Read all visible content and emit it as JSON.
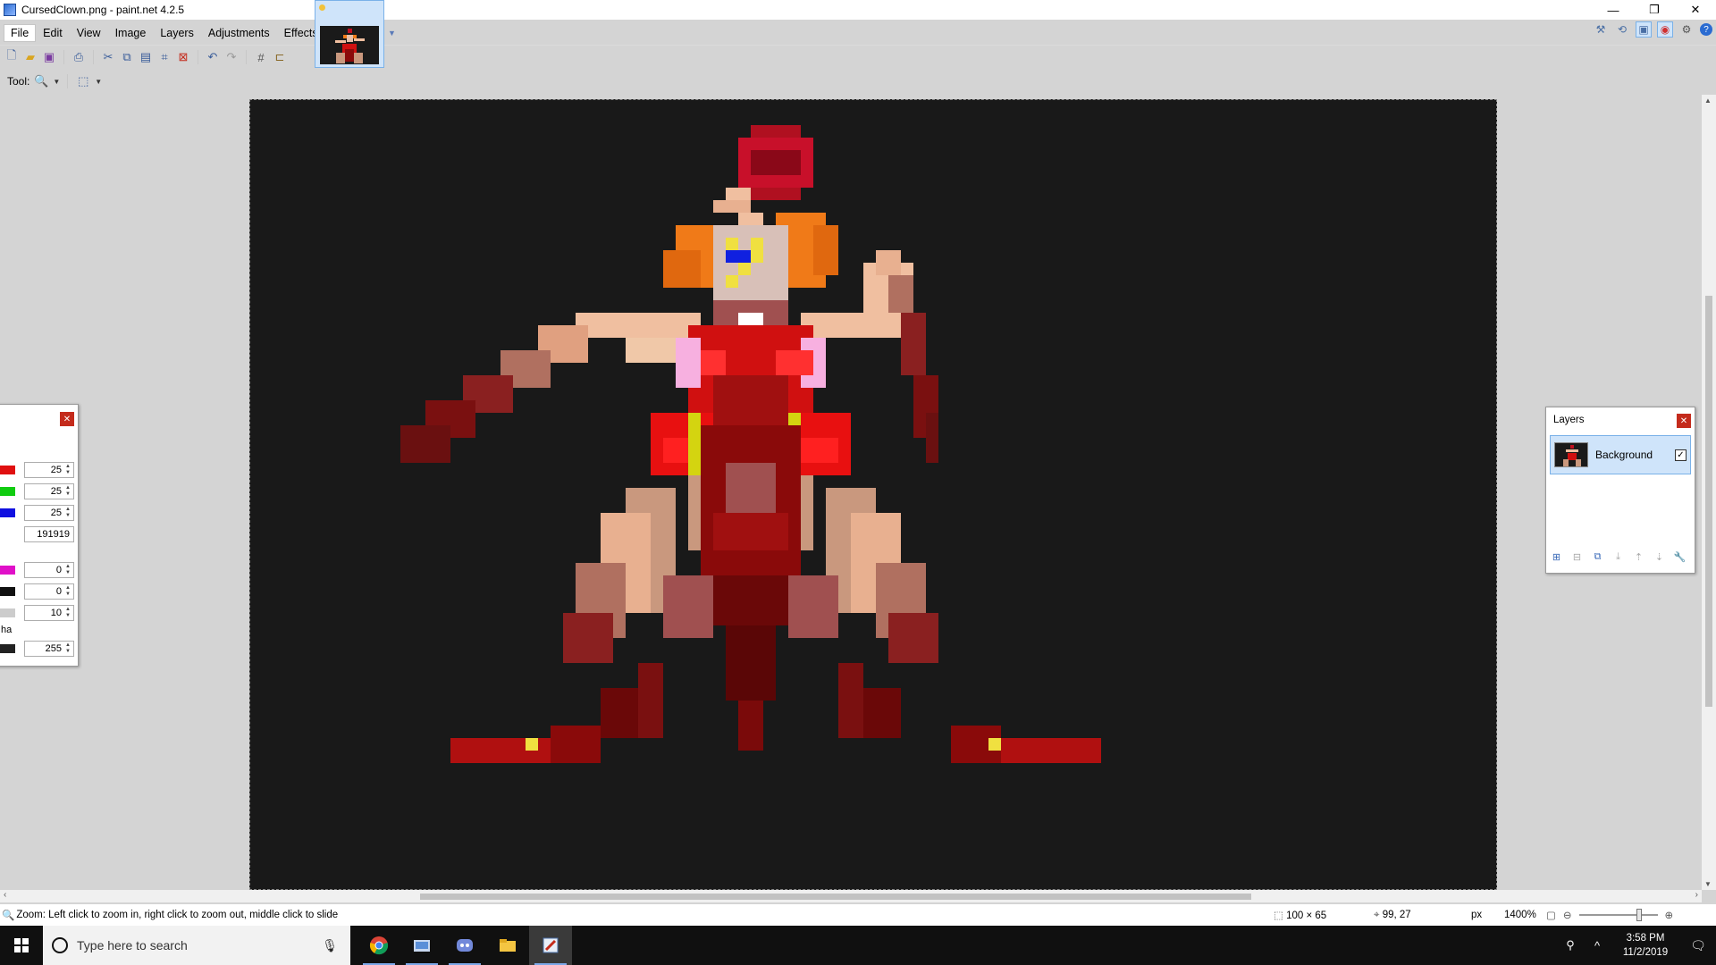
{
  "window": {
    "title": "CursedClown.png - paint.net 4.2.5",
    "controls": [
      "—",
      "❐",
      "✕"
    ]
  },
  "menu": {
    "items": [
      "File",
      "Edit",
      "View",
      "Image",
      "Layers",
      "Adjustments",
      "Effects"
    ]
  },
  "toolrow": {
    "label": "Tool:",
    "tool_icon": "zoom-icon",
    "selection_icon": "selection-mode-icon"
  },
  "statusbar": {
    "hint": "Zoom: Left click to zoom in, right click to zoom out, middle click to slide",
    "image_size": "100 × 65",
    "cursor_pos": "99, 27",
    "unit": "px",
    "zoom": "1400%"
  },
  "colors_panel": {
    "rows": [
      {
        "color": "#e01010",
        "value": "25"
      },
      {
        "color": "#10cc10",
        "value": "25"
      },
      {
        "color": "#1010e0",
        "value": "25"
      },
      {
        "color": "#ffffff",
        "value": "191919"
      },
      {
        "color": "#e010c8",
        "value": "0"
      },
      {
        "color": "#111111",
        "value": "0"
      },
      {
        "color": "#cccccc",
        "value": "10"
      },
      {
        "color": "#222222",
        "value": "255"
      }
    ],
    "alpha_label": "ha"
  },
  "layers_panel": {
    "title": "Layers",
    "layers": [
      {
        "name": "Background",
        "visible": true
      }
    ]
  },
  "taskbar": {
    "search_placeholder": "Type here to search",
    "time": "3:58 PM",
    "date": "11/2/2019"
  }
}
